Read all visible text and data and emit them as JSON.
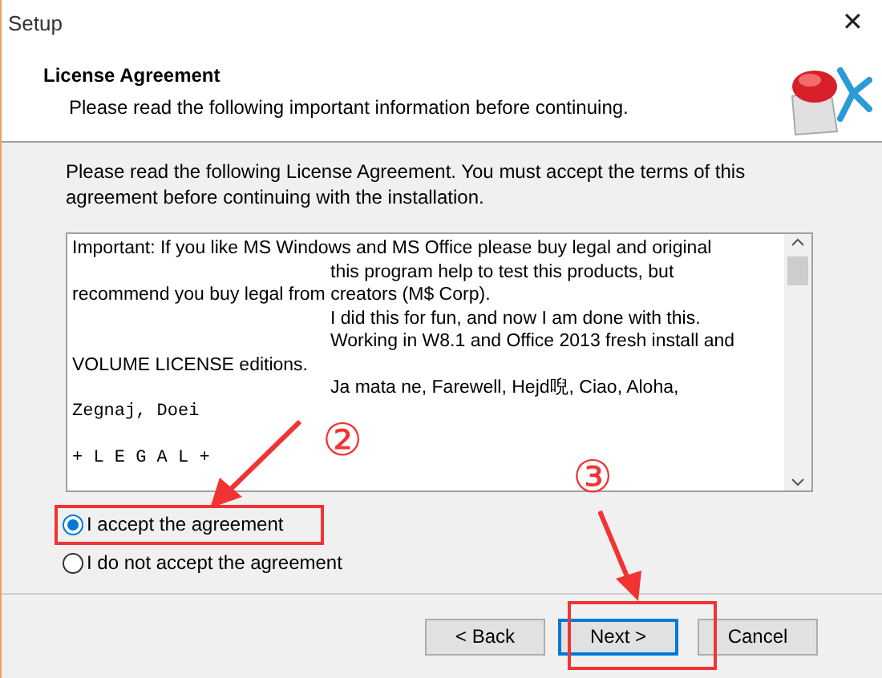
{
  "window": {
    "title": "Setup",
    "close": "✕"
  },
  "header": {
    "title": "License Agreement",
    "subtitle": "Please read the following important information before continuing."
  },
  "intro": "Please read the following License Agreement. You must accept the terms of this agreement before continuing with the installation.",
  "license_lines": [
    {
      "kind": "plain",
      "text": "Important: If you like MS Windows and MS Office please buy legal and original"
    },
    {
      "kind": "indent",
      "text": "this program help to test this products, but"
    },
    {
      "kind": "plain",
      "text": "recommend you buy legal from creators (M$ Corp)."
    },
    {
      "kind": "indent",
      "text": "I did this for fun, and now I am done with this."
    },
    {
      "kind": "indent",
      "text": "Working in W8.1 and Office 2013 fresh install and"
    },
    {
      "kind": "plain",
      "text": "VOLUME LICENSE editions."
    },
    {
      "kind": "indent",
      "text": "Ja mata ne, Farewell, Hejd唲, Ciao, Aloha,"
    },
    {
      "kind": "mono",
      "text": "Zegnaj, Doei"
    },
    {
      "kind": "mono-gap",
      "text": "+ L E G A L +"
    }
  ],
  "options": [
    {
      "label": "I accept the agreement",
      "selected": true
    },
    {
      "label": "I do not accept the agreement",
      "selected": false
    }
  ],
  "buttons": [
    {
      "label": "< Back",
      "default": false
    },
    {
      "label": "Next >",
      "default": true
    },
    {
      "label": "Cancel",
      "default": false
    }
  ],
  "annotations": [
    {
      "label": "②"
    },
    {
      "label": "③"
    }
  ]
}
